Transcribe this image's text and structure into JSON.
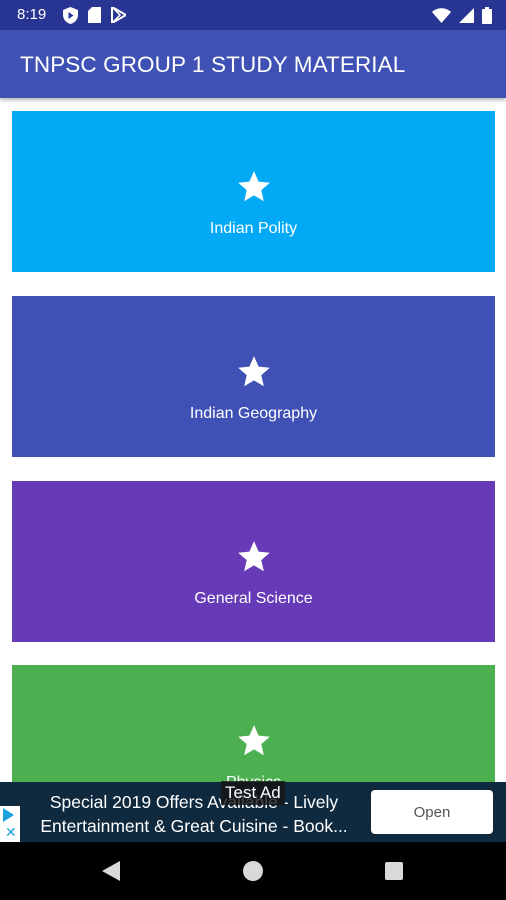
{
  "status_bar": {
    "time": "8:19",
    "left_icons": [
      "shield-play-icon",
      "sd-card-icon",
      "play-store-icon"
    ],
    "right_icons": [
      "wifi-icon",
      "signal-icon",
      "battery-icon"
    ],
    "background": "#283593"
  },
  "app_bar": {
    "title": "TNPSC GROUP 1 STUDY MATERIAL",
    "background": "#3f51b5"
  },
  "categories": [
    {
      "label": "Indian Polity",
      "color": "#03a9f4",
      "icon": "star-icon"
    },
    {
      "label": "Indian Geography",
      "color": "#3f51b5",
      "icon": "star-icon"
    },
    {
      "label": "General Science",
      "color": "#673ab7",
      "icon": "star-icon"
    },
    {
      "label": "Physics",
      "color": "#4caf50",
      "icon": "star-icon"
    }
  ],
  "ad": {
    "text_line1": "Special 2019 Offers Available - Lively",
    "text_line2": "Entertainment & Great Cuisine - Book...",
    "button_label": "Open",
    "test_label": "Test Ad",
    "background": "#0f2a3f"
  },
  "nav_bar": {
    "buttons": [
      "back-icon",
      "home-icon",
      "recents-icon"
    ]
  }
}
